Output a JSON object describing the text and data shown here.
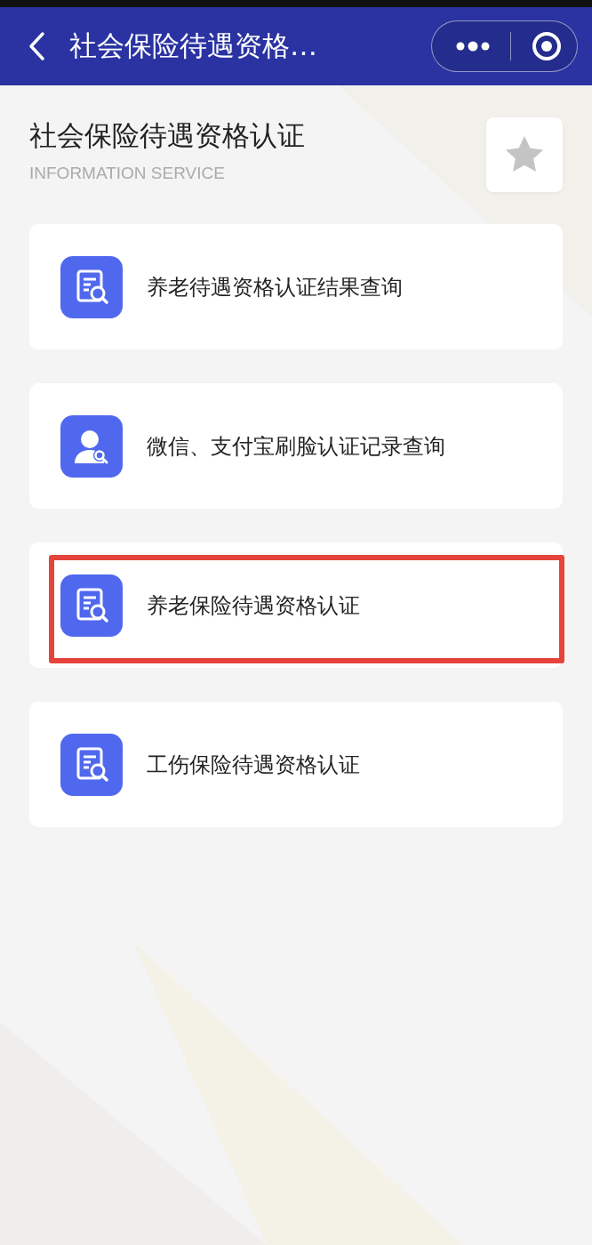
{
  "nav_bar": {
    "title": "社会保险待遇资格…"
  },
  "header": {
    "title": "社会保险待遇资格认证",
    "subtitle": "INFORMATION SERVICE",
    "favorited": false
  },
  "items": [
    {
      "label": "养老待遇资格认证结果查询",
      "kind": "document",
      "highlighted": false
    },
    {
      "label": "微信、支付宝刷脸认证记录查询",
      "kind": "person",
      "highlighted": false
    },
    {
      "label": "养老保险待遇资格认证",
      "kind": "document",
      "highlighted": true
    },
    {
      "label": "工伤保险待遇资格认证",
      "kind": "document",
      "highlighted": false
    }
  ]
}
